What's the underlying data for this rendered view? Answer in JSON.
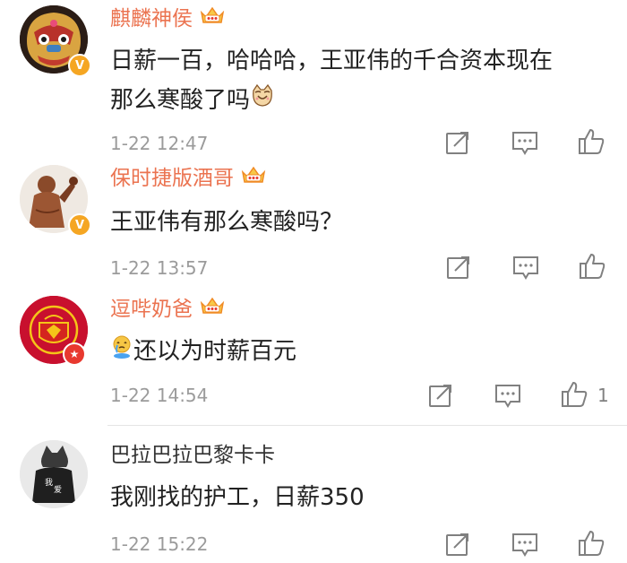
{
  "comments": [
    {
      "username": "麒麟神侯",
      "text_lines": [
        "日薪一百，哈哈哈，王亚伟的千合资本现在",
        "那么寒酸了吗"
      ],
      "emoji": "cat-face-icon",
      "time": "1-22 12:47",
      "like_count": "",
      "verified": true,
      "vip_crown": true
    },
    {
      "username": "保时捷版酒哥",
      "text_lines": [
        "王亚伟有那么寒酸吗？"
      ],
      "time": "1-22 13:57",
      "like_count": "",
      "verified": true,
      "vip_crown": true
    },
    {
      "username": "逗哔奶爸",
      "text_lines": [
        "还以为时薪百元"
      ],
      "emoji": "crying-emoji-icon",
      "time": "1-22 14:54",
      "like_count": "1",
      "verified": true,
      "vip_crown": true
    },
    {
      "username": "巴拉巴拉巴黎卡卡",
      "text_lines": [
        "我刚找的护工，日薪350"
      ],
      "time": "1-22 15:22",
      "like_count": "",
      "verified": false,
      "vip_crown": false
    }
  ],
  "colors": {
    "username_vip": "#eb7350",
    "username_plain": "#333333",
    "text": "#222222",
    "meta": "#9b9b9b",
    "icon": "#808080",
    "verified_gold": "#f5a623",
    "verified_red": "#e8392f"
  }
}
